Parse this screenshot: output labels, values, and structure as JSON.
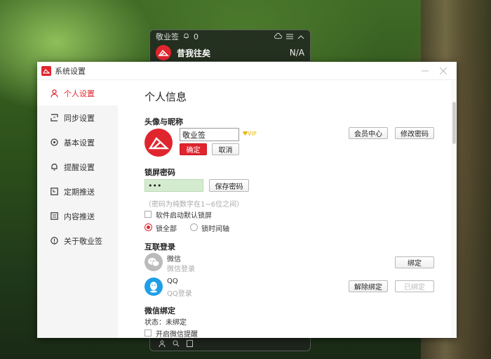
{
  "mini_widget": {
    "title": "敬业签",
    "reminder_count": "0",
    "note_title": "昔我往矣",
    "note_value": "N/A"
  },
  "window": {
    "title": "系统设置"
  },
  "sidebar": {
    "items": [
      {
        "label": "个人设置",
        "icon": "user-icon"
      },
      {
        "label": "同步设置",
        "icon": "sync-icon"
      },
      {
        "label": "基本设置",
        "icon": "settings-icon"
      },
      {
        "label": "提醒设置",
        "icon": "bell-icon"
      },
      {
        "label": "定期推送",
        "icon": "schedule-icon"
      },
      {
        "label": "内容推送",
        "icon": "content-icon"
      },
      {
        "label": "关于敬业签",
        "icon": "info-icon"
      }
    ]
  },
  "personal": {
    "page_title": "个人信息",
    "avatar_section": "头像与昵称",
    "nickname_value": "敬业签",
    "vip_label": "VIP",
    "confirm_label": "确定",
    "cancel_label": "取消",
    "member_center_label": "会员中心",
    "change_password_label": "修改密码",
    "lock_section": "锁屏密码",
    "lock_password_value": "•••",
    "save_password_label": "保存密码",
    "password_hint": "（密码为纯数字在1~6位之间）",
    "auto_lock_label": "软件启动默认锁屏",
    "lock_all_label": "锁全部",
    "lock_timeline_label": "锁时间轴",
    "social_section": "互联登录",
    "wechat_name": "微信",
    "wechat_sub": "微信登录",
    "wechat_bind_label": "绑定",
    "qq_name": "QQ",
    "qq_sub": "QQ登录",
    "qq_unbind_label": "解除绑定",
    "qq_bound_label": "已绑定",
    "wechat_bind_section": "微信绑定",
    "bind_status": "状态：未绑定",
    "wechat_reminder_label": "开启微信提醒"
  },
  "colors": {
    "accent": "#e0252e",
    "password_field": "#d4ebd0"
  }
}
